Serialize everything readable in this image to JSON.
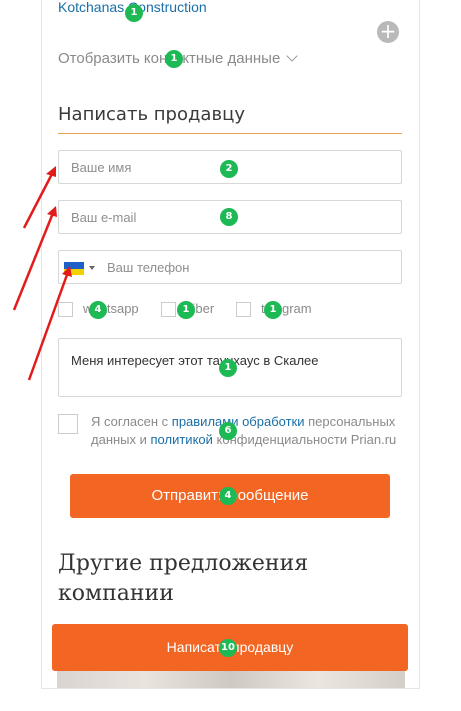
{
  "top_link": "Kotchanas Construction",
  "contacts_toggle": "Отобразить контактные данные",
  "form": {
    "title": "Написать продавцу",
    "name_placeholder": "Ваше имя",
    "email_placeholder": "Ваш e-mail",
    "phone_placeholder": "Ваш телефон",
    "messengers": [
      "whatsapp",
      "viber",
      "telegram"
    ],
    "message": "Меня интересует этот таунхаус в Скалее",
    "consent": {
      "prefix": "Я согласен с ",
      "link_rules": "правилами обработки",
      "middle": " персональных данных и ",
      "link_policy": "политикой",
      "suffix": " конфиденциальности Prian.ru"
    },
    "submit_label": "Отправить сообщение"
  },
  "other_offers_title": "Другие предложения компании",
  "write_seller_label": "Написать продавцу",
  "badges": [
    "1",
    "1",
    "2",
    "8",
    "4",
    "1",
    "1",
    "1",
    "6",
    "4",
    "10"
  ],
  "colors": {
    "accent": "#f26522",
    "link": "#1a6fa8",
    "badge": "#1db954",
    "arrow": "#e21b1b"
  }
}
